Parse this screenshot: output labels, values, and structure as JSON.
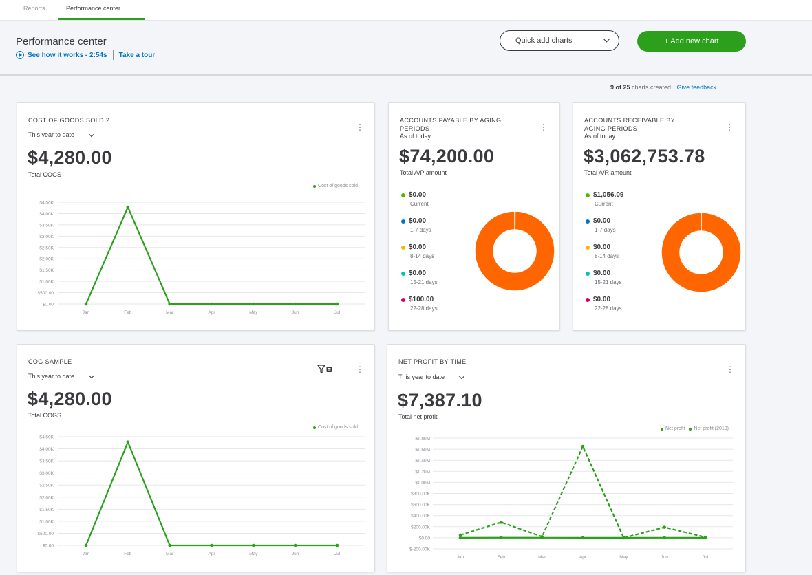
{
  "nav": {
    "tabs": [
      {
        "label": "Reports"
      },
      {
        "label": "Performance center"
      }
    ]
  },
  "header": {
    "title": "Performance center",
    "video_link": "See how it works - 2:54s",
    "tour_link": "Take a tour",
    "quick_add_label": "Quick add charts",
    "add_button_label": "+ Add new chart"
  },
  "status": {
    "count_value": "9 of 25",
    "count_suffix": "charts created",
    "feedback_label": "Give feedback"
  },
  "colors": {
    "accent": "#2ca01c",
    "link": "#0077c5",
    "donut": "#ff6600"
  },
  "cards": {
    "cogs2": {
      "title": "COST OF GOODS SOLD 2",
      "period": "This year to date",
      "amount": "$4,280.00",
      "caption": "Total COGS",
      "legend": [
        "Cost of goods sold"
      ]
    },
    "ap": {
      "title_line1": "ACCOUNTS PAYABLE BY AGING",
      "title_line2": "PERIODS",
      "asof": "As of today",
      "amount": "$74,200.00",
      "caption": "Total A/P amount",
      "items": [
        {
          "amount": "$0.00",
          "label": "Current",
          "color": "#53b700"
        },
        {
          "amount": "$0.00",
          "label": "1-7 days",
          "color": "#0077c5"
        },
        {
          "amount": "$0.00",
          "label": "8-14 days",
          "color": "#ffb600"
        },
        {
          "amount": "$0.00",
          "label": "15-21 days",
          "color": "#00c1bf"
        },
        {
          "amount": "$100.00",
          "label": "22-28 days",
          "color": "#c9007a"
        }
      ]
    },
    "ar": {
      "title_line1": "ACCOUNTS RECEIVABLE BY",
      "title_line2": "AGING PERIODS",
      "asof": "As of today",
      "amount": "$3,062,753.78",
      "caption": "Total A/R amount",
      "items": [
        {
          "amount": "$1,056.09",
          "label": "Current",
          "color": "#53b700"
        },
        {
          "amount": "$0.00",
          "label": "1-7 days",
          "color": "#0077c5"
        },
        {
          "amount": "$0.00",
          "label": "8-14 days",
          "color": "#ffb600"
        },
        {
          "amount": "$0.00",
          "label": "15-21 days",
          "color": "#00c1bf"
        },
        {
          "amount": "$0.00",
          "label": "22-28 days",
          "color": "#c9007a"
        }
      ]
    },
    "cogsample": {
      "title": "COG SAMPLE",
      "period": "This year to date",
      "amount": "$4,280.00",
      "caption": "Total COGS",
      "legend": [
        "Cost of goods sold"
      ]
    },
    "netprofit": {
      "title": "NET PROFIT BY TIME",
      "period": "This year to date",
      "amount": "$7,387.10",
      "caption": "Total net profit",
      "legend": [
        "Net profit",
        "Net profit (2019)"
      ]
    }
  },
  "chart_data": [
    {
      "type": "line",
      "chart": "cogs2",
      "categories": [
        "Jan",
        "Feb",
        "Mar",
        "Apr",
        "May",
        "Jun",
        "Jul"
      ],
      "y_ticks": [
        "$4.50K",
        "$4.00K",
        "$3.50K",
        "$3.00K",
        "$2.50K",
        "$2.00K",
        "$1.50K",
        "$1.00K",
        "$500.00",
        "$0.00"
      ],
      "ylim": [
        0,
        4500
      ],
      "series": [
        {
          "name": "Cost of goods sold",
          "values": [
            0,
            4280,
            0,
            0,
            0,
            0,
            0
          ],
          "color": "#2ca01c",
          "dashed": false
        }
      ],
      "grid": true
    },
    {
      "type": "line",
      "chart": "cogsample",
      "categories": [
        "Jan",
        "Feb",
        "Mar",
        "Apr",
        "May",
        "Jun",
        "Jul"
      ],
      "y_ticks": [
        "$4.50K",
        "$4.00K",
        "$3.50K",
        "$3.00K",
        "$2.50K",
        "$2.00K",
        "$1.50K",
        "$1.00K",
        "$500.00",
        "$0.00"
      ],
      "ylim": [
        0,
        4500
      ],
      "series": [
        {
          "name": "Cost of goods sold",
          "values": [
            0,
            4280,
            0,
            0,
            0,
            0,
            0
          ],
          "color": "#2ca01c",
          "dashed": false
        }
      ],
      "grid": true
    },
    {
      "type": "line",
      "chart": "netprofit",
      "categories": [
        "Jan",
        "Feb",
        "Mar",
        "Apr",
        "May",
        "Jun",
        "Jul"
      ],
      "y_ticks": [
        "$1.80M",
        "$1.60M",
        "$1.40M",
        "$1.20M",
        "$1.00M",
        "$800.00K",
        "$600.00K",
        "$400.00K",
        "$200.00K",
        "$0.00",
        "$-200.00K"
      ],
      "ylim": [
        -200000,
        1800000
      ],
      "series": [
        {
          "name": "Net profit",
          "values": [
            0,
            2000,
            1000,
            0,
            0,
            1000,
            0
          ],
          "color": "#2ca01c",
          "dashed": false
        },
        {
          "name": "Net profit (2019)",
          "values": [
            50000,
            280000,
            20000,
            1650000,
            0,
            190000,
            10000
          ],
          "color": "#2ca01c",
          "dashed": true
        }
      ],
      "grid": true
    },
    {
      "type": "pie",
      "chart": "ap",
      "categories": [
        "Current",
        "1-7 days",
        "8-14 days",
        "15-21 days",
        "22-28 days",
        "Other"
      ],
      "values": [
        0,
        0,
        0,
        0,
        100,
        74100
      ],
      "colors": [
        "#53b700",
        "#0077c5",
        "#ffb600",
        "#00c1bf",
        "#c9007a",
        "#ff6600"
      ]
    },
    {
      "type": "pie",
      "chart": "ar",
      "categories": [
        "Current",
        "1-7 days",
        "8-14 days",
        "15-21 days",
        "22-28 days",
        "Other"
      ],
      "values": [
        1056.09,
        0,
        0,
        0,
        0,
        3061697.69
      ],
      "colors": [
        "#53b700",
        "#0077c5",
        "#ffb600",
        "#00c1bf",
        "#c9007a",
        "#ff6600"
      ]
    }
  ]
}
